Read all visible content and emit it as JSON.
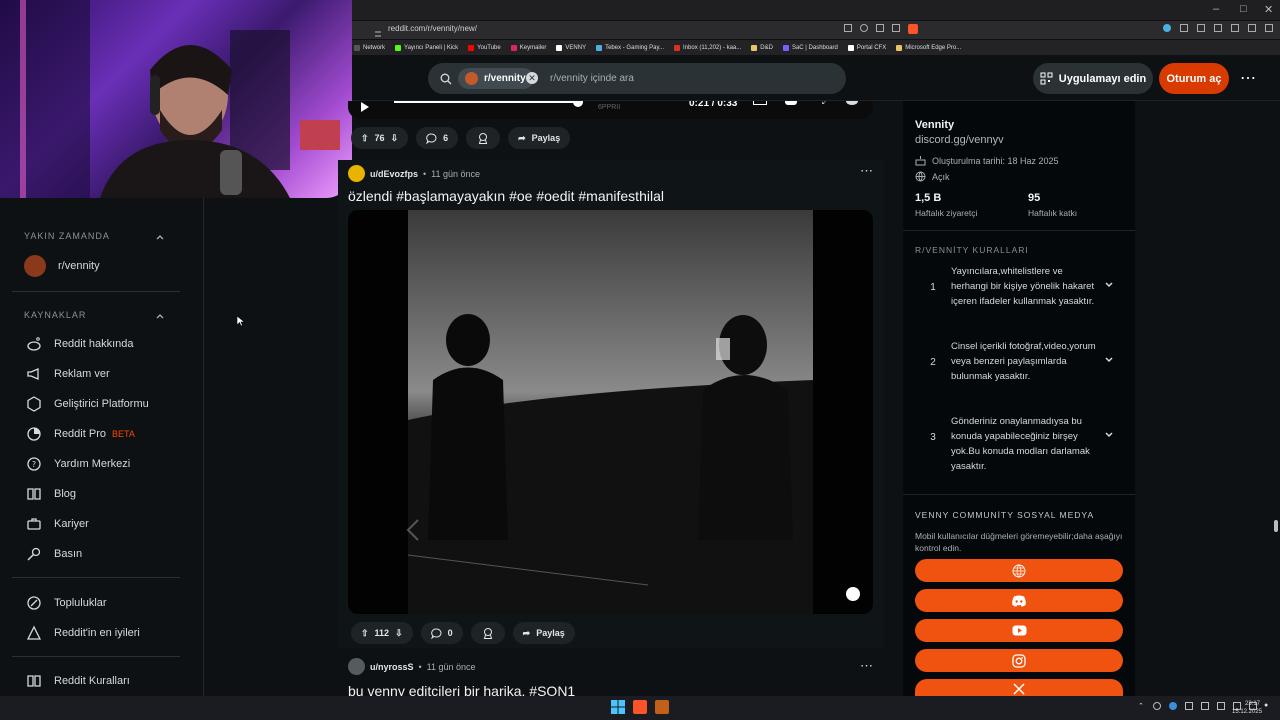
{
  "browser": {
    "url": "reddit.com/r/vennity/new/",
    "bookmarks": [
      {
        "label": "Network",
        "color": "#555555"
      },
      {
        "label": "Yayıncı Paneli | Kick",
        "color": "#53fc18"
      },
      {
        "label": "YouTube",
        "color": "#ff0000"
      },
      {
        "label": "Keymailer",
        "color": "#e0245e"
      },
      {
        "label": "VENNY",
        "color": "#ffffff"
      },
      {
        "label": "Tebex - Gaming Pay...",
        "color": "#4ab0e0"
      },
      {
        "label": "Inbox (11,202) - kaa...",
        "color": "#d93025"
      },
      {
        "label": "D&D",
        "color": "#e8c36a"
      },
      {
        "label": "SaC | Dashboard",
        "color": "#7a5cff"
      },
      {
        "label": "Portal CFX",
        "color": "#ffffff"
      },
      {
        "label": "Microsoft Edge Pro...",
        "color": "#e8c36a"
      }
    ]
  },
  "header": {
    "chip_label": "r/vennity",
    "search_placeholder": "r/vennity içinde ara",
    "get_app_label": "Uygulamayı edin",
    "login_label": "Oturum aç"
  },
  "sidebar": {
    "recent_title": "YAKIN ZAMANDA",
    "recent_items": [
      {
        "label": "r/vennity"
      }
    ],
    "resources_title": "KAYNAKLAR",
    "resources": [
      {
        "label": "Reddit hakkında",
        "icon": "reddit-alien-icon"
      },
      {
        "label": "Reklam ver",
        "icon": "megaphone-icon"
      },
      {
        "label": "Geliştirici Platformu",
        "icon": "dev-platform-icon"
      },
      {
        "label": "Reddit Pro",
        "icon": "pro-icon",
        "badge": "BETA"
      },
      {
        "label": "Yardım Merkezi",
        "icon": "help-icon"
      },
      {
        "label": "Blog",
        "icon": "book-icon"
      },
      {
        "label": "Kariyer",
        "icon": "briefcase-icon"
      },
      {
        "label": "Basın",
        "icon": "microphone-icon"
      }
    ],
    "community_items": [
      {
        "label": "Topluluklar",
        "icon": "communities-icon"
      },
      {
        "label": "Reddit'in en iyileri",
        "icon": "best-of-icon"
      }
    ],
    "bottom_items": [
      {
        "label": "Reddit Kuralları",
        "icon": "rules-book-icon"
      }
    ]
  },
  "feed": {
    "video_time": "0:21 / 0:33",
    "video_watermark": "6PPRII",
    "post0": {
      "votes": "76",
      "comments": "6",
      "share": "Paylaş"
    },
    "post1": {
      "author": "u/dEvozfps",
      "age": "11 gün önce",
      "title": "özlendi #başlamayayakın #oe #oedit #manifesthilal",
      "votes": "112",
      "comments": "0",
      "share": "Paylaş"
    },
    "post2": {
      "author": "u/nyrossS",
      "age": "11 gün önce",
      "title": "bu venny editcileri bir harika. #SON1"
    }
  },
  "community": {
    "name": "Vennity",
    "link": "discord.gg/vennyv",
    "created": "Oluşturulma tarihi: 18 Haz 2025",
    "visibility": "Açık",
    "weekly_visitors": "1,5 B",
    "weekly_visitors_label": "Haftalık ziyaretçi",
    "weekly_contrib": "95",
    "weekly_contrib_label": "Haftalık katkı",
    "rules_title": "R/VENNİTY KURALLARI",
    "rules": [
      {
        "num": "1",
        "text": "Yayıncılara,whitelistlere ve herhangi bir kişiye yönelik hakaret içeren ifadeler kullanmak yasaktır."
      },
      {
        "num": "2",
        "text": "Cinsel içerikli fotoğraf,video,yorum veya benzeri paylaşımlarda bulunmak yasaktır."
      },
      {
        "num": "3",
        "text": "Gönderiniz onaylanmadıysa bu konuda yapabileceğiniz birşey yok.Bu konuda modları darlamak yasaktır."
      }
    ],
    "social_title": "VENNY COMMUNİTY SOSYAL MEDYA",
    "social_note": "Mobil kullanıcılar düğmeleri göremeyebilir;daha aşağıyı kontrol edin.",
    "social_buttons": [
      "globe-icon",
      "discord-icon",
      "youtube-icon",
      "instagram-icon",
      "x-icon"
    ]
  },
  "taskbar": {
    "time": "23:17",
    "date": "15.12.2025"
  },
  "colors": {
    "accent": "#d93a00",
    "social_orange": "#f0530f",
    "bg": "#0e1113"
  }
}
